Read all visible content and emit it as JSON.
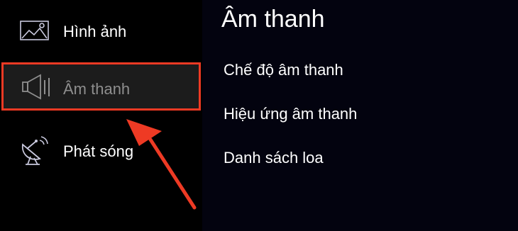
{
  "sidebar": {
    "items": [
      {
        "label": "Hình ảnh",
        "icon": "picture-icon",
        "selected": false
      },
      {
        "label": "Âm thanh",
        "icon": "speaker-icon",
        "selected": true
      },
      {
        "label": "Phát sóng",
        "icon": "satellite-dish-icon",
        "selected": false
      }
    ]
  },
  "content": {
    "title": "Âm thanh",
    "items": [
      {
        "label": "Chế độ âm thanh"
      },
      {
        "label": "Hiệu ứng âm thanh"
      },
      {
        "label": "Danh sách loa"
      }
    ]
  },
  "annotation": {
    "highlight_color": "#ee3a24",
    "arrow_icon": "red-arrow-icon"
  },
  "colors": {
    "sidebar_background": "#000000",
    "content_background": "#03030f",
    "selected_item_background": "#1c1c1c",
    "selected_label": "#8e8e8e",
    "text": "#ffffff"
  }
}
